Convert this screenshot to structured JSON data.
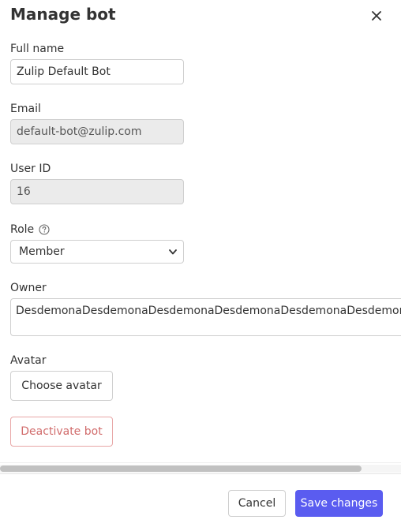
{
  "modal": {
    "title": "Manage bot",
    "close_icon": "close-icon"
  },
  "fields": {
    "full_name": {
      "label": "Full name",
      "value": "Zulip Default Bot"
    },
    "email": {
      "label": "Email",
      "value": "default-bot@zulip.com"
    },
    "user_id": {
      "label": "User ID",
      "value": "16"
    },
    "role": {
      "label": "Role",
      "help_icon": "help-circle-icon",
      "selected": "Member"
    },
    "owner": {
      "label": "Owner",
      "value": "DesdemonaDesdemonaDesdemonaDesdemonaDesdemonaDesdemonaDesdemonaDesdemona"
    },
    "avatar": {
      "label": "Avatar",
      "button_label": "Choose avatar"
    }
  },
  "actions": {
    "deactivate_label": "Deactivate bot",
    "cancel_label": "Cancel",
    "save_label": "Save changes"
  },
  "colors": {
    "primary": "#5a5cf0",
    "danger": "#d16c6c",
    "disabled_bg": "#ebebeb",
    "border": "#cfcfcf"
  },
  "scrollbar": {
    "horizontal_visible_fraction": 0.9
  }
}
